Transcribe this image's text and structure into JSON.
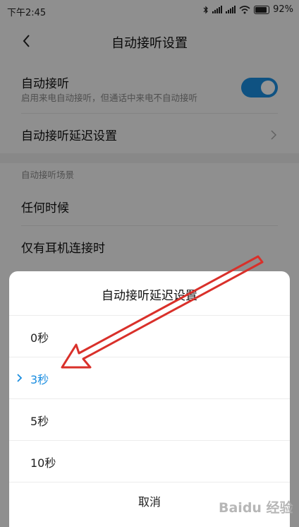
{
  "status_bar": {
    "time": "下午2:45",
    "battery": "92%"
  },
  "header": {
    "title": "自动接听设置",
    "back_icon": "chevron-left-icon"
  },
  "settings": {
    "auto_answer": {
      "label": "自动接听",
      "desc": "启用来电自动接听，但通话中来电不自动接听",
      "enabled": true
    },
    "delay": {
      "label": "自动接听延迟设置"
    },
    "scene_section": {
      "label": "自动接听场景"
    },
    "scenes": [
      {
        "label": "任何时候"
      },
      {
        "label": "仅有耳机连接时"
      }
    ]
  },
  "dialog": {
    "title": "自动接听延迟设置",
    "options": [
      {
        "label": "0秒",
        "selected": false
      },
      {
        "label": "3秒",
        "selected": true
      },
      {
        "label": "5秒",
        "selected": false
      },
      {
        "label": "10秒",
        "selected": false
      }
    ],
    "cancel": "取消"
  },
  "watermark": "Baidu 经验",
  "colors": {
    "accent": "#1a8de0",
    "annotation_arrow": "#d9302a"
  }
}
